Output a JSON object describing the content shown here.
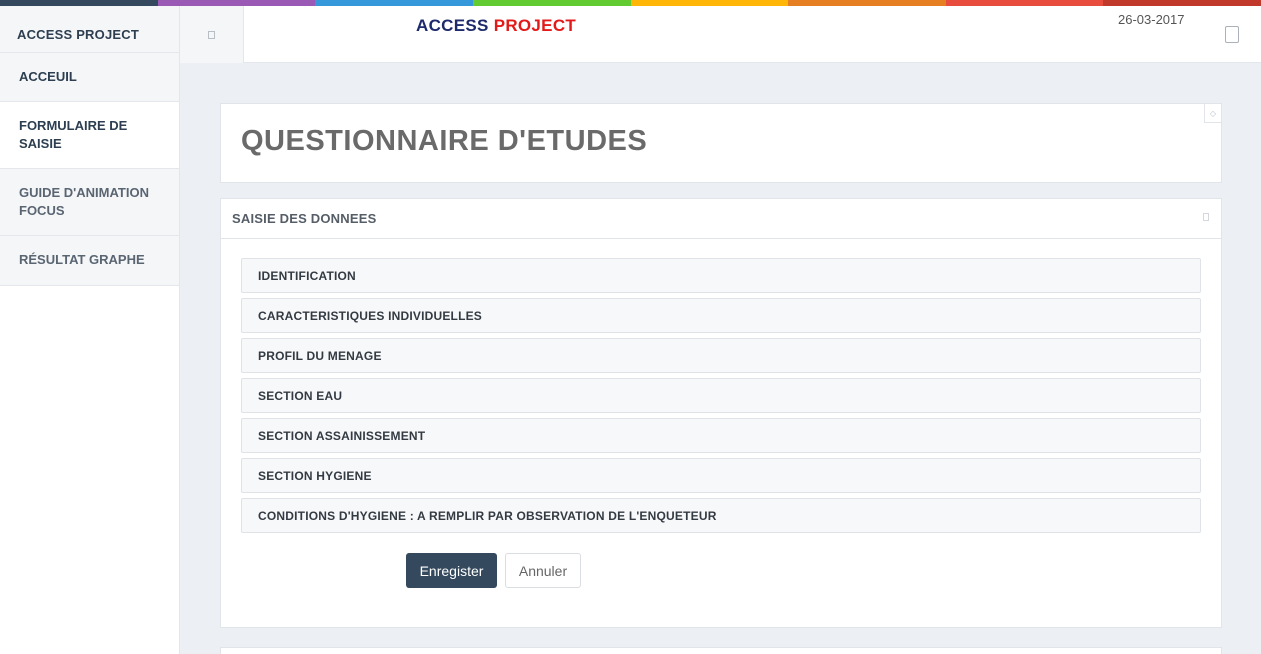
{
  "colors": {
    "stripe": [
      "#34495e",
      "#9b59b6",
      "#3498db",
      "#62cb31",
      "#ffb606",
      "#e67e22",
      "#e74c3c",
      "#c0392b"
    ],
    "primary_button": "#34495e",
    "title_dark": "#1d2a6b",
    "title_red": "#e21a1a"
  },
  "sidebar": {
    "brand": "ACCESS PROJECT",
    "items": [
      {
        "label": "ACCEUIL"
      },
      {
        "label": "FORMULAIRE DE SAISIE"
      },
      {
        "label": "GUIDE D'ANIMATION FOCUS"
      },
      {
        "label": "RÉSULTAT GRAPHE"
      }
    ]
  },
  "header": {
    "title_part1": "ACCESS",
    "title_part2": "PROJECT",
    "date": "26-03-2017",
    "toggle_icon": "menu-toggle-icon",
    "right_icon": "document-icon"
  },
  "main": {
    "page_title": "QUESTIONNAIRE D'ETUDES",
    "panel_title": "SAISIE DES DONNEES",
    "sections": [
      {
        "label": "IDENTIFICATION"
      },
      {
        "label": "CARACTERISTIQUES INDIVIDUELLES"
      },
      {
        "label": "PROFIL DU MENAGE"
      },
      {
        "label": "SECTION EAU"
      },
      {
        "label": "SECTION ASSAINISSEMENT"
      },
      {
        "label": "SECTION HYGIENE"
      },
      {
        "label": "CONDITIONS D'HYGIENE : A REMPLIR PAR OBSERVATION DE L'ENQUETEUR"
      }
    ],
    "save_label": "Enregister",
    "cancel_label": "Annuler"
  }
}
